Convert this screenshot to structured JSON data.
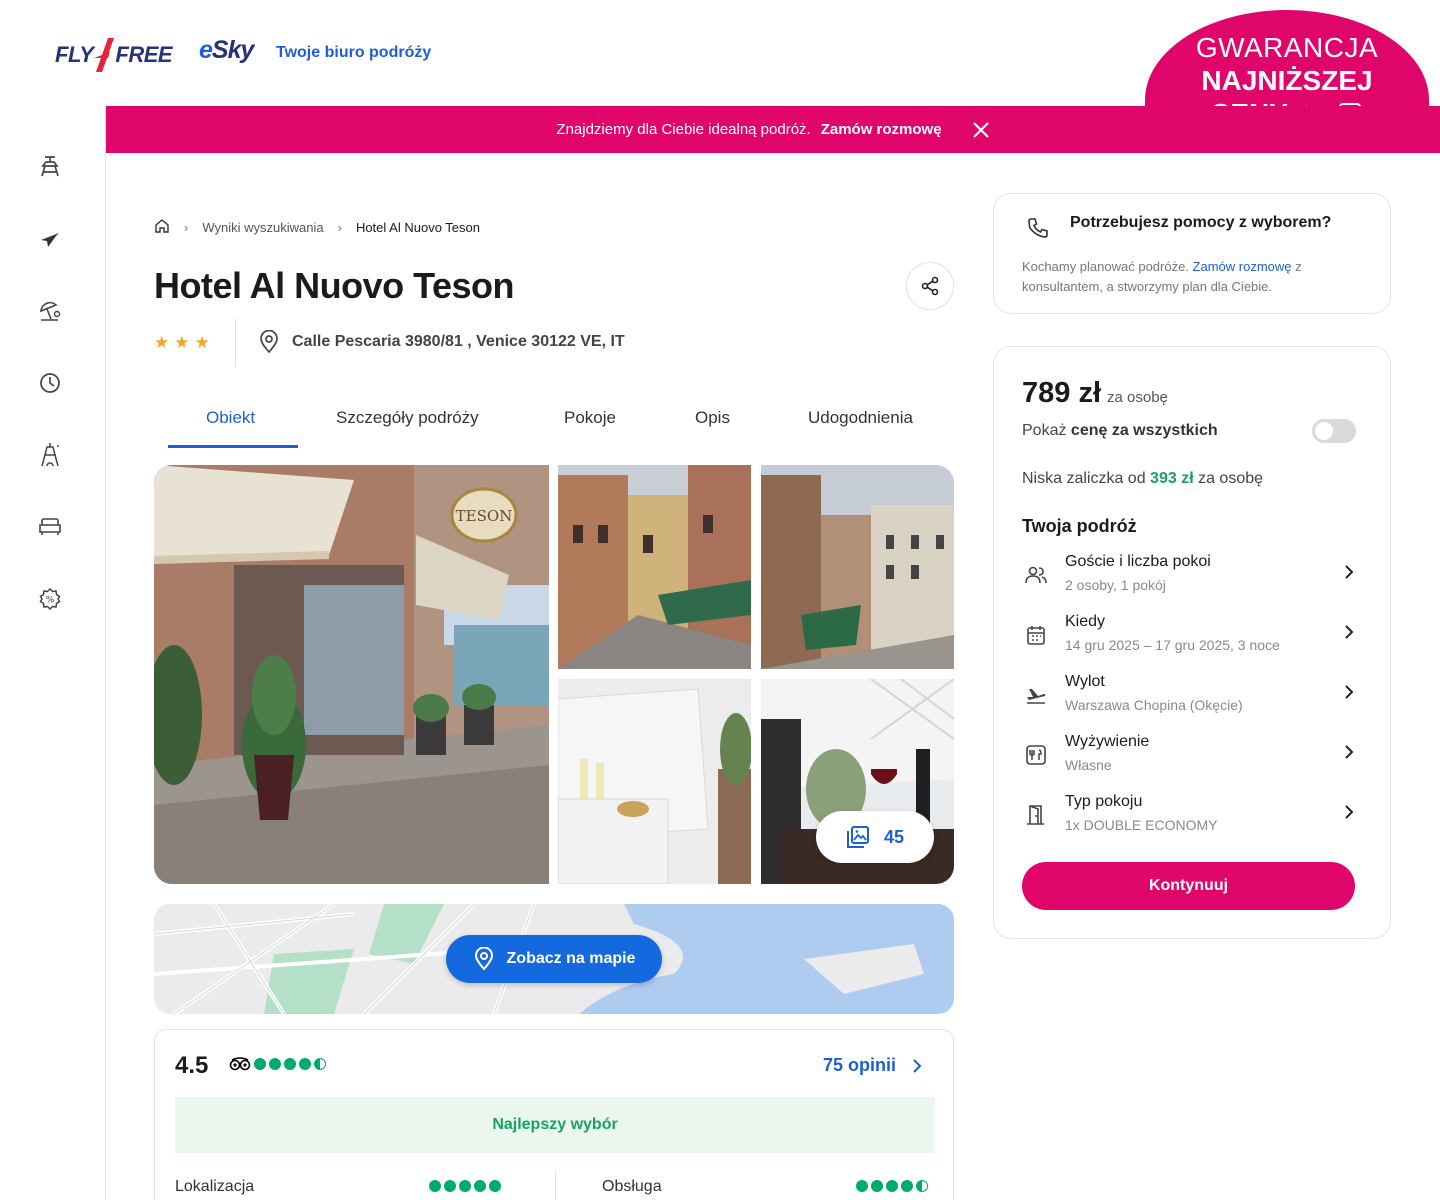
{
  "header": {
    "logo_fly": "FLY",
    "logo_free": "FREE",
    "logo_esky_e": "e",
    "logo_esky_rest": "Sky",
    "tagline": "Twoje biuro podróży",
    "guarantee": {
      "line1": "GWARANCJA",
      "line2": "NAJNIŻSZEJ",
      "line3": "CENY"
    }
  },
  "promo": {
    "text": "Znajdziemy dla Ciebie idealną podróż.",
    "cta": "Zamów rozmowę"
  },
  "sidebar": {
    "icons": [
      "beach-chair-icon",
      "plane-icon",
      "sun-umbrella-icon",
      "clock-icon",
      "eiffel-tower-icon",
      "sofa-icon",
      "discount-icon"
    ]
  },
  "breadcrumb": {
    "items": [
      "Wyniki wyszukiwania",
      "Hotel Al Nuovo Teson"
    ]
  },
  "hotel": {
    "name": "Hotel Al Nuovo Teson",
    "stars": 3,
    "address": "Calle Pescaria 3980/81 , Venice 30122 VE, IT"
  },
  "tabs": [
    "Obiekt",
    "Szczegóły podróży",
    "Pokoje",
    "Opis",
    "Udogodnienia"
  ],
  "gallery": {
    "photo_count": "45",
    "sign_text": "TESON"
  },
  "map": {
    "button": "Zobacz na mapie"
  },
  "reviews": {
    "rating": "4.5",
    "count_label": "75 opinii",
    "badge": "Najlepszy wybór",
    "categories": [
      {
        "name": "Lokalizacja",
        "score": 5
      },
      {
        "name": "Obsługa",
        "score": 4.5
      }
    ]
  },
  "help": {
    "title": "Potrzebujesz pomocy z wyborem?",
    "text_before": "Kochamy planować podróże. ",
    "link": "Zamów rozmowę",
    "text_after": " z konsultantem, a stworzymy plan dla Ciebie."
  },
  "booking": {
    "price": "789 zł",
    "per_person": "za osobę",
    "show_all_prefix": "Pokaż ",
    "show_all_bold": "cenę za wszystkich",
    "deposit_prefix": "Niska zaliczka od ",
    "deposit_amount": "393 zł",
    "deposit_suffix": " za osobę",
    "trip_title": "Twoja podróż",
    "rows": [
      {
        "label": "Goście i liczba pokoi",
        "value": "2 osoby, 1 pokój",
        "icon": "guests-icon"
      },
      {
        "label": "Kiedy",
        "value": "14 gru 2025 – 17 gru 2025, 3 noce",
        "icon": "calendar-icon"
      },
      {
        "label": "Wylot",
        "value": "Warszawa Chopina (Okęcie)",
        "icon": "departure-icon"
      },
      {
        "label": "Wyżywienie",
        "value": "Własne",
        "icon": "meal-icon"
      },
      {
        "label": "Typ pokoju",
        "value": "1x DOUBLE ECONOMY",
        "icon": "door-icon"
      }
    ],
    "continue": "Kontynuuj"
  },
  "colors": {
    "brand_pink": "#e0056b",
    "brand_blue": "#1c5fd9",
    "navy": "#26327a",
    "green": "#1aa260",
    "tripadvisor": "#00aa6c"
  }
}
